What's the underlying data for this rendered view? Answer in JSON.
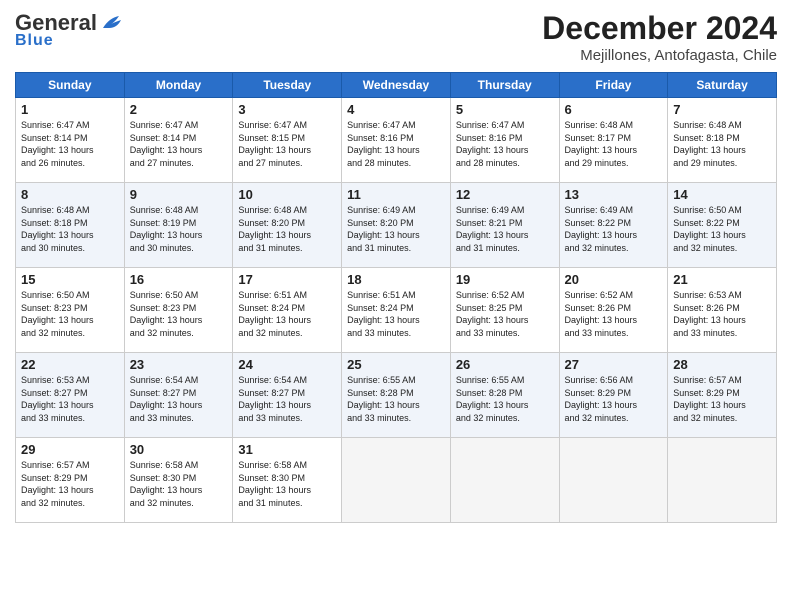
{
  "logo": {
    "line1a": "General",
    "line1b": "Blue",
    "line2": "Blue"
  },
  "title": {
    "month": "December 2024",
    "location": "Mejillones, Antofagasta, Chile"
  },
  "days_of_week": [
    "Sunday",
    "Monday",
    "Tuesday",
    "Wednesday",
    "Thursday",
    "Friday",
    "Saturday"
  ],
  "weeks": [
    [
      {
        "day": "1",
        "lines": [
          "Sunrise: 6:47 AM",
          "Sunset: 8:14 PM",
          "Daylight: 13 hours",
          "and 26 minutes."
        ]
      },
      {
        "day": "2",
        "lines": [
          "Sunrise: 6:47 AM",
          "Sunset: 8:14 PM",
          "Daylight: 13 hours",
          "and 27 minutes."
        ]
      },
      {
        "day": "3",
        "lines": [
          "Sunrise: 6:47 AM",
          "Sunset: 8:15 PM",
          "Daylight: 13 hours",
          "and 27 minutes."
        ]
      },
      {
        "day": "4",
        "lines": [
          "Sunrise: 6:47 AM",
          "Sunset: 8:16 PM",
          "Daylight: 13 hours",
          "and 28 minutes."
        ]
      },
      {
        "day": "5",
        "lines": [
          "Sunrise: 6:47 AM",
          "Sunset: 8:16 PM",
          "Daylight: 13 hours",
          "and 28 minutes."
        ]
      },
      {
        "day": "6",
        "lines": [
          "Sunrise: 6:48 AM",
          "Sunset: 8:17 PM",
          "Daylight: 13 hours",
          "and 29 minutes."
        ]
      },
      {
        "day": "7",
        "lines": [
          "Sunrise: 6:48 AM",
          "Sunset: 8:18 PM",
          "Daylight: 13 hours",
          "and 29 minutes."
        ]
      }
    ],
    [
      {
        "day": "8",
        "lines": [
          "Sunrise: 6:48 AM",
          "Sunset: 8:18 PM",
          "Daylight: 13 hours",
          "and 30 minutes."
        ]
      },
      {
        "day": "9",
        "lines": [
          "Sunrise: 6:48 AM",
          "Sunset: 8:19 PM",
          "Daylight: 13 hours",
          "and 30 minutes."
        ]
      },
      {
        "day": "10",
        "lines": [
          "Sunrise: 6:48 AM",
          "Sunset: 8:20 PM",
          "Daylight: 13 hours",
          "and 31 minutes."
        ]
      },
      {
        "day": "11",
        "lines": [
          "Sunrise: 6:49 AM",
          "Sunset: 8:20 PM",
          "Daylight: 13 hours",
          "and 31 minutes."
        ]
      },
      {
        "day": "12",
        "lines": [
          "Sunrise: 6:49 AM",
          "Sunset: 8:21 PM",
          "Daylight: 13 hours",
          "and 31 minutes."
        ]
      },
      {
        "day": "13",
        "lines": [
          "Sunrise: 6:49 AM",
          "Sunset: 8:22 PM",
          "Daylight: 13 hours",
          "and 32 minutes."
        ]
      },
      {
        "day": "14",
        "lines": [
          "Sunrise: 6:50 AM",
          "Sunset: 8:22 PM",
          "Daylight: 13 hours",
          "and 32 minutes."
        ]
      }
    ],
    [
      {
        "day": "15",
        "lines": [
          "Sunrise: 6:50 AM",
          "Sunset: 8:23 PM",
          "Daylight: 13 hours",
          "and 32 minutes."
        ]
      },
      {
        "day": "16",
        "lines": [
          "Sunrise: 6:50 AM",
          "Sunset: 8:23 PM",
          "Daylight: 13 hours",
          "and 32 minutes."
        ]
      },
      {
        "day": "17",
        "lines": [
          "Sunrise: 6:51 AM",
          "Sunset: 8:24 PM",
          "Daylight: 13 hours",
          "and 32 minutes."
        ]
      },
      {
        "day": "18",
        "lines": [
          "Sunrise: 6:51 AM",
          "Sunset: 8:24 PM",
          "Daylight: 13 hours",
          "and 33 minutes."
        ]
      },
      {
        "day": "19",
        "lines": [
          "Sunrise: 6:52 AM",
          "Sunset: 8:25 PM",
          "Daylight: 13 hours",
          "and 33 minutes."
        ]
      },
      {
        "day": "20",
        "lines": [
          "Sunrise: 6:52 AM",
          "Sunset: 8:26 PM",
          "Daylight: 13 hours",
          "and 33 minutes."
        ]
      },
      {
        "day": "21",
        "lines": [
          "Sunrise: 6:53 AM",
          "Sunset: 8:26 PM",
          "Daylight: 13 hours",
          "and 33 minutes."
        ]
      }
    ],
    [
      {
        "day": "22",
        "lines": [
          "Sunrise: 6:53 AM",
          "Sunset: 8:27 PM",
          "Daylight: 13 hours",
          "and 33 minutes."
        ]
      },
      {
        "day": "23",
        "lines": [
          "Sunrise: 6:54 AM",
          "Sunset: 8:27 PM",
          "Daylight: 13 hours",
          "and 33 minutes."
        ]
      },
      {
        "day": "24",
        "lines": [
          "Sunrise: 6:54 AM",
          "Sunset: 8:27 PM",
          "Daylight: 13 hours",
          "and 33 minutes."
        ]
      },
      {
        "day": "25",
        "lines": [
          "Sunrise: 6:55 AM",
          "Sunset: 8:28 PM",
          "Daylight: 13 hours",
          "and 33 minutes."
        ]
      },
      {
        "day": "26",
        "lines": [
          "Sunrise: 6:55 AM",
          "Sunset: 8:28 PM",
          "Daylight: 13 hours",
          "and 32 minutes."
        ]
      },
      {
        "day": "27",
        "lines": [
          "Sunrise: 6:56 AM",
          "Sunset: 8:29 PM",
          "Daylight: 13 hours",
          "and 32 minutes."
        ]
      },
      {
        "day": "28",
        "lines": [
          "Sunrise: 6:57 AM",
          "Sunset: 8:29 PM",
          "Daylight: 13 hours",
          "and 32 minutes."
        ]
      }
    ],
    [
      {
        "day": "29",
        "lines": [
          "Sunrise: 6:57 AM",
          "Sunset: 8:29 PM",
          "Daylight: 13 hours",
          "and 32 minutes."
        ]
      },
      {
        "day": "30",
        "lines": [
          "Sunrise: 6:58 AM",
          "Sunset: 8:30 PM",
          "Daylight: 13 hours",
          "and 32 minutes."
        ]
      },
      {
        "day": "31",
        "lines": [
          "Sunrise: 6:58 AM",
          "Sunset: 8:30 PM",
          "Daylight: 13 hours",
          "and 31 minutes."
        ]
      },
      null,
      null,
      null,
      null
    ]
  ]
}
